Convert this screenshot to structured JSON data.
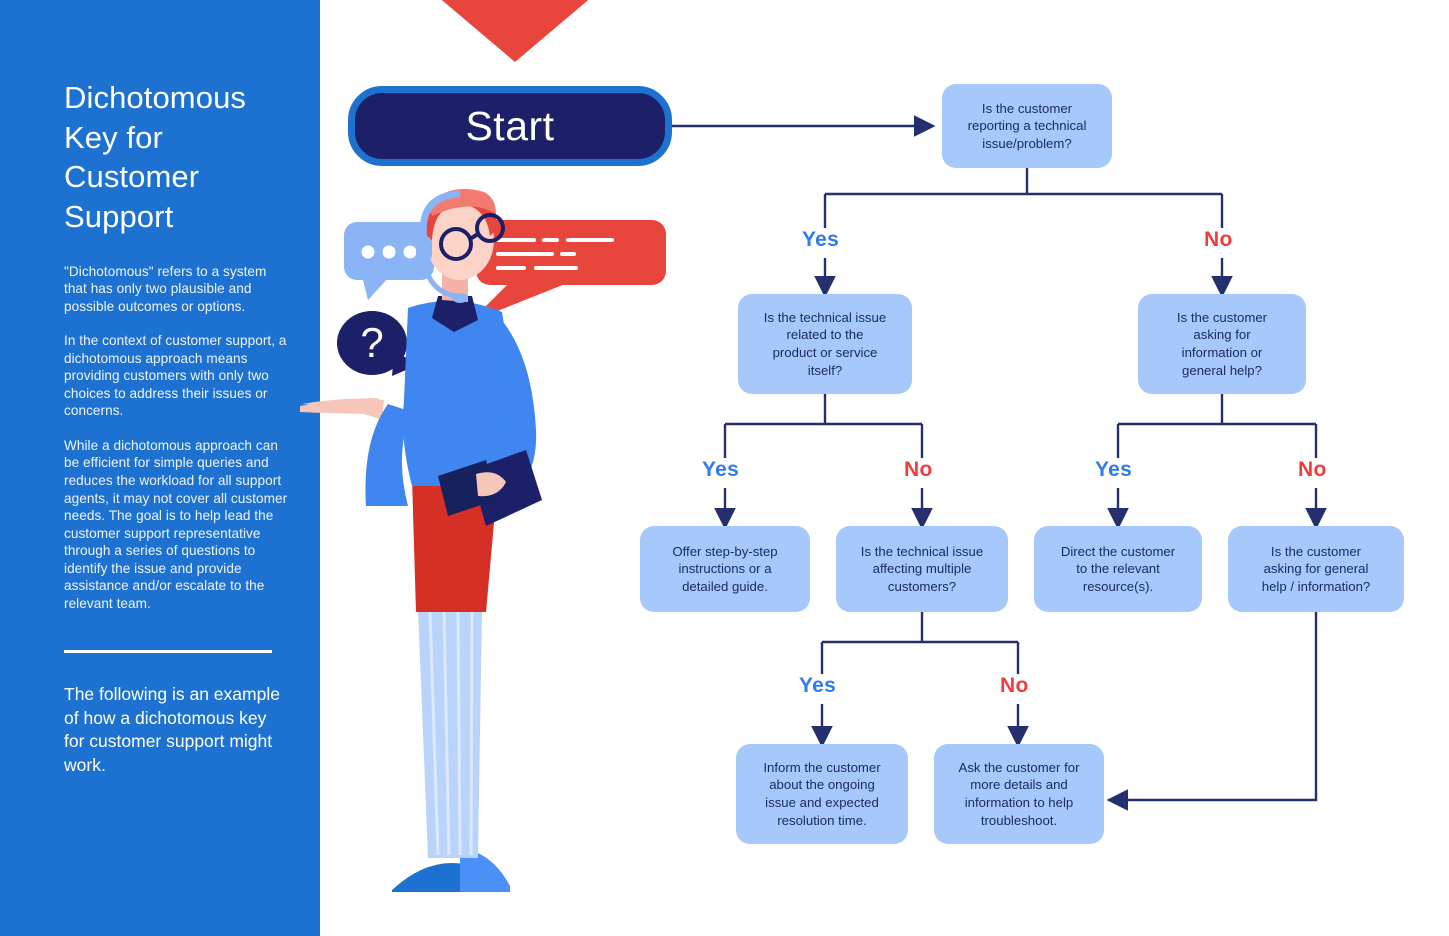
{
  "sidebar": {
    "title": "Dichotomous\nKey for\nCustomer\nSupport",
    "paragraphs": [
      "\"Dichotomous\" refers to a system that has only two plausible and possible outcomes or options.",
      "In the context of customer support, a dichotomous approach means providing customers with only two choices to address their issues or concerns.",
      "While a dichotomous approach can be efficient for simple queries and reduces the workload for all support agents, it may not cover all customer needs. The goal is to help lead the customer support representative through a series of questions to identify the issue and provide assistance and/or escalate to the relevant team."
    ],
    "footer": "The following is an example of how a dichotomous key for customer support might work.",
    "bg_color": "#1d72d1"
  },
  "flow": {
    "start_label": "Start",
    "nodes": {
      "q1": "Is the customer\nreporting a technical\nissue/problem?",
      "q2_left": "Is the technical issue\nrelated to the\nproduct or service\nitself?",
      "q2_right": "Is the customer\nasking for\ninformation or\ngeneral help?",
      "a3_1": "Offer step-by-step\ninstructions or a\ndetailed guide.",
      "q3_2": "Is the technical issue\naffecting multiple\ncustomers?",
      "a3_3": "Direct the customer\nto the relevant\nresource(s).",
      "q3_4": "Is the customer\nasking for general\nhelp / information?",
      "a4_1": "Inform the customer\nabout the ongoing\nissue and expected\nresolution time.",
      "a4_2": "Ask the customer for\nmore details and\ninformation to help\ntroubleshoot."
    },
    "labels": {
      "yes": "Yes",
      "no": "No"
    },
    "colors": {
      "node_fill": "#a6c8fb",
      "node_text": "#1b2a6b",
      "start_fill": "#1b2068",
      "start_border": "#1d72d1",
      "connector": "#262f6e",
      "yes": "#2f7bf0",
      "no": "#ef3d3d",
      "accent_red": "#e8453c"
    }
  },
  "illustration": {
    "name": "customer-support-agent",
    "elements": [
      "red-triangle-accent",
      "blue-dots-speech-bubble",
      "red-lines-speech-bubble",
      "navy-question-bubble",
      "agent-with-headset"
    ]
  }
}
